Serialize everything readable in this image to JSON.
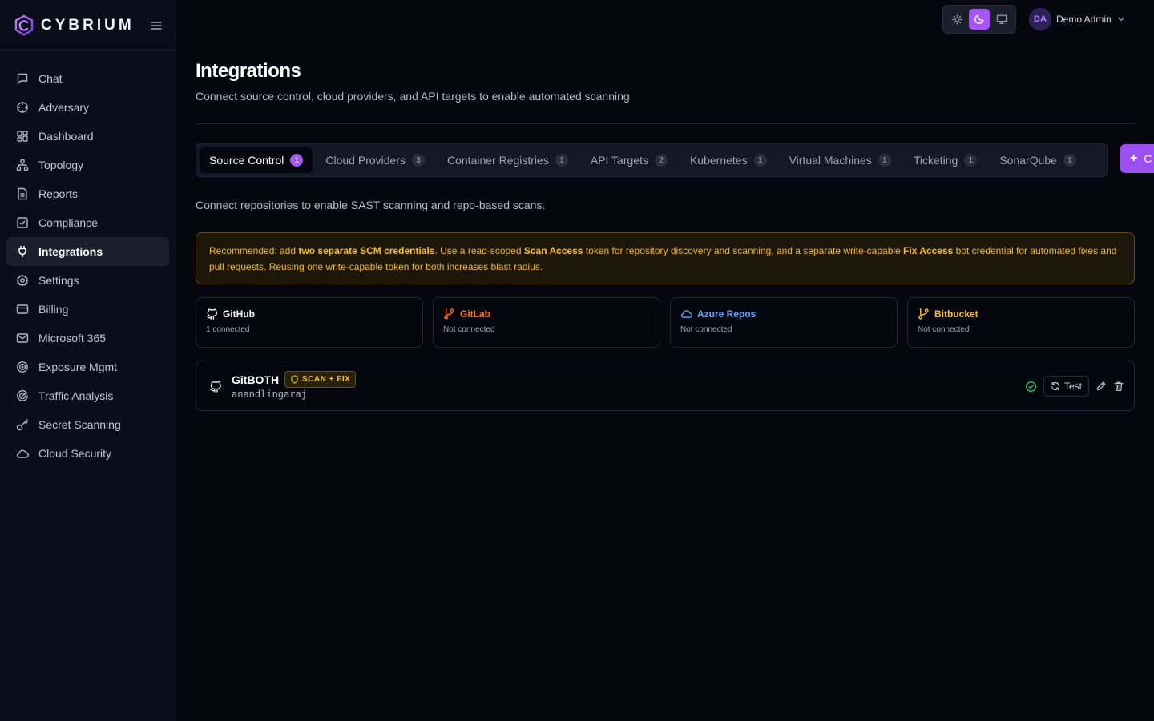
{
  "brand": {
    "name": "CYBRIUM"
  },
  "sidebar": {
    "items": [
      {
        "label": "Chat",
        "icon": "message-square-icon"
      },
      {
        "label": "Adversary",
        "icon": "crosshair-icon"
      },
      {
        "label": "Dashboard",
        "icon": "layout-dashboard-icon"
      },
      {
        "label": "Topology",
        "icon": "network-icon"
      },
      {
        "label": "Reports",
        "icon": "file-text-icon"
      },
      {
        "label": "Compliance",
        "icon": "check-square-icon"
      },
      {
        "label": "Integrations",
        "icon": "plug-icon",
        "active": true
      },
      {
        "label": "Settings",
        "icon": "gear-icon"
      },
      {
        "label": "Billing",
        "icon": "wallet-icon"
      },
      {
        "label": "Microsoft 365",
        "icon": "mail-icon"
      },
      {
        "label": "Exposure Mgmt",
        "icon": "target-icon"
      },
      {
        "label": "Traffic Analysis",
        "icon": "radar-icon"
      },
      {
        "label": "Secret Scanning",
        "icon": "key-icon"
      },
      {
        "label": "Cloud Security",
        "icon": "cloud-icon"
      }
    ]
  },
  "header": {
    "theme_modes": [
      "light",
      "dark",
      "system"
    ],
    "active_theme": "dark",
    "user": {
      "initials": "DA",
      "name": "Demo Admin"
    }
  },
  "page": {
    "title": "Integrations",
    "subtitle": "Connect source control, cloud providers, and API targets to enable automated scanning"
  },
  "tabs": [
    {
      "label": "Source Control",
      "count": "1",
      "active": true
    },
    {
      "label": "Cloud Providers",
      "count": "3"
    },
    {
      "label": "Container Registries",
      "count": "1"
    },
    {
      "label": "API Targets",
      "count": "2"
    },
    {
      "label": "Kubernetes",
      "count": "1"
    },
    {
      "label": "Virtual Machines",
      "count": "1"
    },
    {
      "label": "Ticketing",
      "count": "1"
    },
    {
      "label": "SonarQube",
      "count": "1"
    }
  ],
  "add_button": {
    "label": "C"
  },
  "section": {
    "description": "Connect repositories to enable SAST scanning and repo-based scans."
  },
  "alert": {
    "prefix": "Recommended: add ",
    "bold1": "two separate SCM credentials",
    "mid1": ". Use a read-scoped ",
    "bold2": "Scan Access",
    "mid2": " token for repository discovery and scanning, and a separate write-capable ",
    "bold3": "Fix Access",
    "suffix": " bot credential for automated fixes and pull requests. Reusing one write-capable token for both increases blast radius."
  },
  "providers": [
    {
      "name": "GitHub",
      "status": "1 connected",
      "color": "#ffffff",
      "icon": "github-icon"
    },
    {
      "name": "GitLab",
      "status": "Not connected",
      "color": "#f97316",
      "icon": "git-branch-icon"
    },
    {
      "name": "Azure Repos",
      "status": "Not connected",
      "color": "#60a5fa",
      "icon": "cloud-icon"
    },
    {
      "name": "Bitbucket",
      "status": "Not connected",
      "color": "#fbbf24",
      "icon": "git-branch-icon"
    }
  ],
  "credential": {
    "name": "GitBOTH",
    "badge": "SCAN + FIX",
    "username": "anandlingaraj",
    "test_label": "Test",
    "status": "connected"
  },
  "colors": {
    "accent": "#a855f7",
    "warning": "#fbbf24",
    "success": "#22c55e"
  }
}
